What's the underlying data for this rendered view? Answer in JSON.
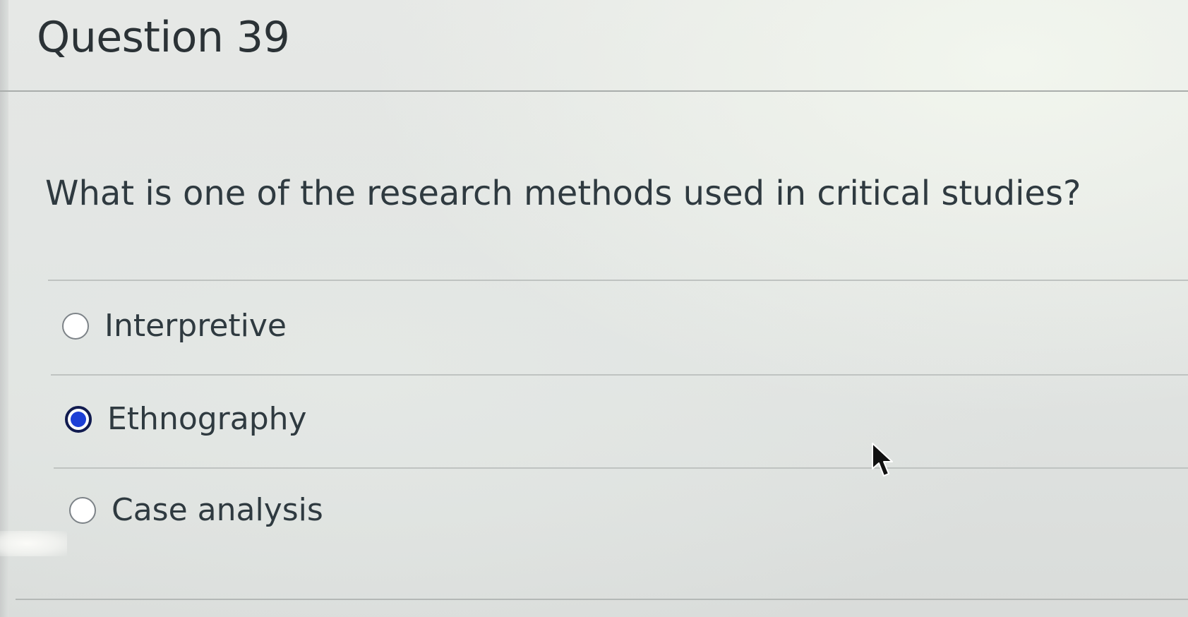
{
  "question": {
    "header": "Question 39",
    "prompt": "What is one of the research methods used in critical studies?",
    "options": [
      {
        "label": "Interpretive",
        "selected": false
      },
      {
        "label": "Ethnography",
        "selected": true
      },
      {
        "label": "Case analysis",
        "selected": false
      }
    ]
  },
  "colors": {
    "radio_selected_fill": "#1d3fd6",
    "radio_selected_ring": "#111b4f",
    "text": "#2f3a40"
  },
  "icons": {
    "pointer": "mouse-pointer-icon"
  }
}
